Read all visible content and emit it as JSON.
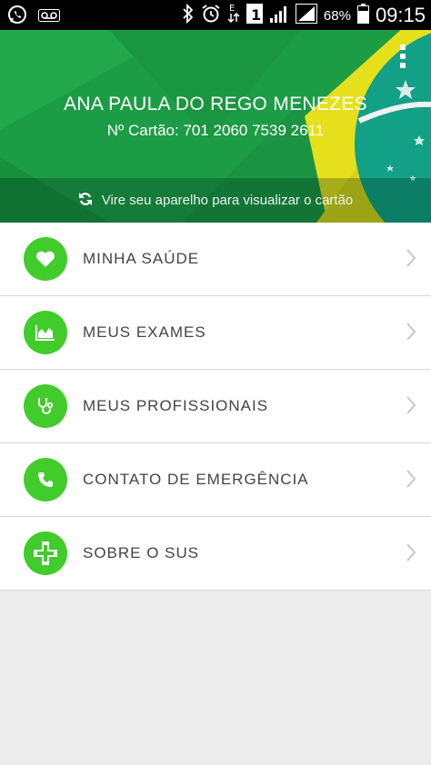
{
  "status_bar": {
    "battery_percent": "68%",
    "time": "09:15",
    "icons": [
      "whatsapp-icon",
      "voicemail-icon",
      "bluetooth-icon",
      "alarm-icon",
      "data-arrows-icon",
      "sim-1-icon",
      "signal-icon",
      "signal-icon",
      "battery-icon"
    ]
  },
  "header": {
    "user_name": "ANA PAULA DO REGO MENEZES",
    "card_number": "Nº Cartão: 701 2060 7539 2611",
    "rotate_hint": "Vire seu aparelho para visualizar o cartão",
    "menu_icon": "more-vert-icon",
    "colors": {
      "green": "#1a9a44",
      "yellow": "#e8e21a",
      "blue": "#14a08a"
    }
  },
  "menu": {
    "accent_color": "#41cc2b",
    "items": [
      {
        "label": "MINHA SAÚDE",
        "icon": "heart-icon"
      },
      {
        "label": "MEUS EXAMES",
        "icon": "chart-icon"
      },
      {
        "label": "MEUS PROFISSIONAIS",
        "icon": "stethoscope-icon"
      },
      {
        "label": "CONTATO DE EMERGÊNCIA",
        "icon": "phone-icon"
      },
      {
        "label": "SOBRE O SUS",
        "icon": "cross-icon"
      }
    ]
  }
}
